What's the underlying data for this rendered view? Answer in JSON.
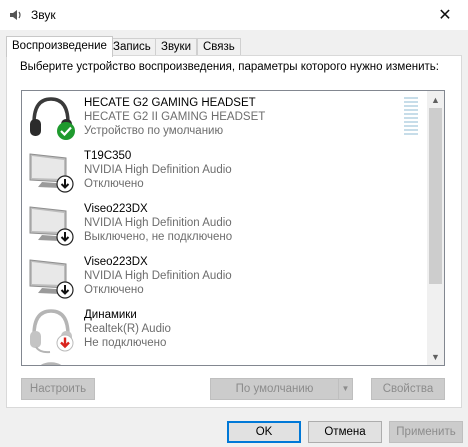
{
  "window": {
    "title": "Звук",
    "close_glyph": "✕"
  },
  "tabs": [
    {
      "label": "Воспроизведение",
      "active": true
    },
    {
      "label": "Запись",
      "active": false
    },
    {
      "label": "Звуки",
      "active": false
    },
    {
      "label": "Связь",
      "active": false
    }
  ],
  "instruction": "Выберите устройство воспроизведения, параметры которого нужно изменить:",
  "devices": [
    {
      "name": "HECATE G2 GAMING HEADSET",
      "sub": "HECATE G2 II GAMING HEADSET",
      "state": "Устройство по умолчанию",
      "icon": "headset-icon",
      "badge": "default-check-icon"
    },
    {
      "name": "T19C350",
      "sub": "NVIDIA High Definition Audio",
      "state": "Отключено",
      "icon": "monitor-icon",
      "badge": "disabled-arrow-icon"
    },
    {
      "name": "Viseo223DX",
      "sub": "NVIDIA High Definition Audio",
      "state": "Выключено, не подключено",
      "icon": "monitor-icon",
      "badge": "disabled-arrow-icon"
    },
    {
      "name": "Viseo223DX",
      "sub": "NVIDIA High Definition Audio",
      "state": "Отключено",
      "icon": "monitor-icon",
      "badge": "disabled-arrow-icon"
    },
    {
      "name": "Динамики",
      "sub": "Realtek(R) Audio",
      "state": "Не подключено",
      "icon": "headset-icon",
      "badge": "unplugged-arrow-icon"
    }
  ],
  "buttons": {
    "configure": "Настроить",
    "set_default": "По умолчанию",
    "properties": "Свойства",
    "ok": "OK",
    "cancel": "Отмена",
    "apply": "Применить"
  },
  "colors": {
    "accent": "#0078d7",
    "check_badge": "#1f9a2e",
    "unplugged_badge": "#d9231d"
  }
}
